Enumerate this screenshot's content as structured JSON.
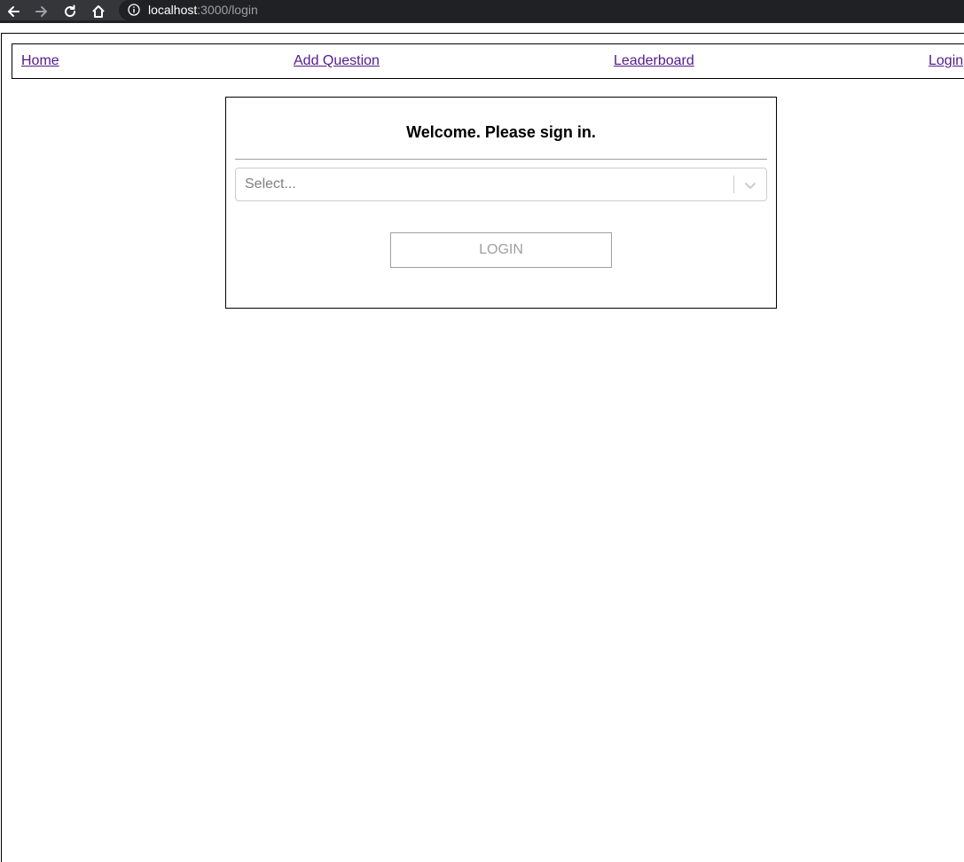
{
  "browser": {
    "url_host": "localhost",
    "url_path": ":3000/login"
  },
  "nav": {
    "home": "Home",
    "add_question": "Add Question",
    "leaderboard": "Leaderboard",
    "login": "Login"
  },
  "login_card": {
    "title": "Welcome. Please sign in.",
    "select_placeholder": "Select...",
    "login_button": "LOGIN"
  },
  "icons": {
    "back": "arrow-left-icon",
    "forward": "arrow-right-icon",
    "reload": "reload-icon",
    "home": "home-icon",
    "info": "info-icon",
    "dropdown": "chevron-down-icon"
  },
  "colors": {
    "link_visited": "#551a8b",
    "toolbar_bg": "#35363a",
    "omnibox_bg": "#202124",
    "disabled_text": "#a0a0a0"
  }
}
